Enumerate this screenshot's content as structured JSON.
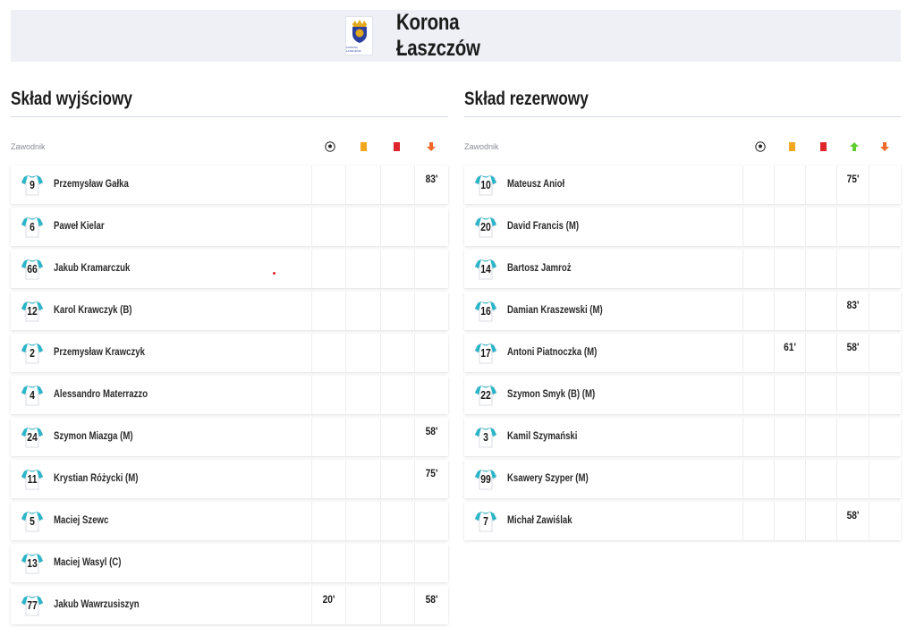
{
  "team": {
    "name": "Korona Łaszczów",
    "logo_label": "KORONA ŁASZCZÓW",
    "colors": {
      "logo_blue": "#2b3f9e",
      "logo_gold": "#e1a81b"
    }
  },
  "colors": {
    "yellow_card": "#f1a81e",
    "red_card": "#e0242b",
    "sub_in": "#5fcc2f",
    "sub_out": "#f06a2b",
    "shirt_teal": "#29b6c9"
  },
  "lineup": {
    "title": "Skład wyjściowy",
    "header_label": "Zawodnik",
    "icons": [
      "ball-icon",
      "yellow-card-icon",
      "red-card-icon",
      "sub-out-icon"
    ],
    "players": [
      {
        "number": "9",
        "name": "Przemysław Gałka",
        "goal": "",
        "yellow": "",
        "red": "",
        "out": "83'"
      },
      {
        "number": "6",
        "name": "Paweł Kielar",
        "goal": "",
        "yellow": "",
        "red": "",
        "out": ""
      },
      {
        "number": "66",
        "name": "Jakub Kramarczuk",
        "goal": "",
        "yellow": "",
        "red": "",
        "out": ""
      },
      {
        "number": "12",
        "name": "Karol Krawczyk (B)",
        "goal": "",
        "yellow": "",
        "red": "",
        "out": ""
      },
      {
        "number": "2",
        "name": "Przemysław Krawczyk",
        "goal": "",
        "yellow": "",
        "red": "",
        "out": ""
      },
      {
        "number": "4",
        "name": "Alessandro Materrazzo",
        "goal": "",
        "yellow": "",
        "red": "",
        "out": ""
      },
      {
        "number": "24",
        "name": "Szymon Miazga (M)",
        "goal": "",
        "yellow": "",
        "red": "",
        "out": "58'"
      },
      {
        "number": "11",
        "name": "Krystian Różycki (M)",
        "goal": "",
        "yellow": "",
        "red": "",
        "out": "75'"
      },
      {
        "number": "5",
        "name": "Maciej Szewc",
        "goal": "",
        "yellow": "",
        "red": "",
        "out": ""
      },
      {
        "number": "13",
        "name": "Maciej Wasyl (C)",
        "goal": "",
        "yellow": "",
        "red": "",
        "out": ""
      },
      {
        "number": "77",
        "name": "Jakub Wawrzusiszyn",
        "goal": "20'",
        "yellow": "",
        "red": "",
        "out": "58'"
      }
    ]
  },
  "reserves": {
    "title": "Skład rezerwowy",
    "header_label": "Zawodnik",
    "icons": [
      "ball-icon",
      "yellow-card-icon",
      "red-card-icon",
      "sub-in-icon",
      "sub-out-icon"
    ],
    "players": [
      {
        "number": "10",
        "name": "Mateusz Anioł",
        "goal": "",
        "yellow": "",
        "red": "",
        "in": "75'",
        "out": ""
      },
      {
        "number": "20",
        "name": "David Francis (M)",
        "goal": "",
        "yellow": "",
        "red": "",
        "in": "",
        "out": ""
      },
      {
        "number": "14",
        "name": "Bartosz Jamroż",
        "goal": "",
        "yellow": "",
        "red": "",
        "in": "",
        "out": ""
      },
      {
        "number": "16",
        "name": "Damian Kraszewski (M)",
        "goal": "",
        "yellow": "",
        "red": "",
        "in": "83'",
        "out": ""
      },
      {
        "number": "17",
        "name": "Antoni Piatnoczka (M)",
        "goal": "",
        "yellow": "61'",
        "red": "",
        "in": "58'",
        "out": ""
      },
      {
        "number": "22",
        "name": "Szymon Smyk (B) (M)",
        "goal": "",
        "yellow": "",
        "red": "",
        "in": "",
        "out": ""
      },
      {
        "number": "3",
        "name": "Kamil Szymański",
        "goal": "",
        "yellow": "",
        "red": "",
        "in": "",
        "out": ""
      },
      {
        "number": "99",
        "name": "Ksawery Szyper (M)",
        "goal": "",
        "yellow": "",
        "red": "",
        "in": "",
        "out": ""
      },
      {
        "number": "7",
        "name": "Michał Zawiślak",
        "goal": "",
        "yellow": "",
        "red": "",
        "in": "58'",
        "out": ""
      }
    ]
  }
}
